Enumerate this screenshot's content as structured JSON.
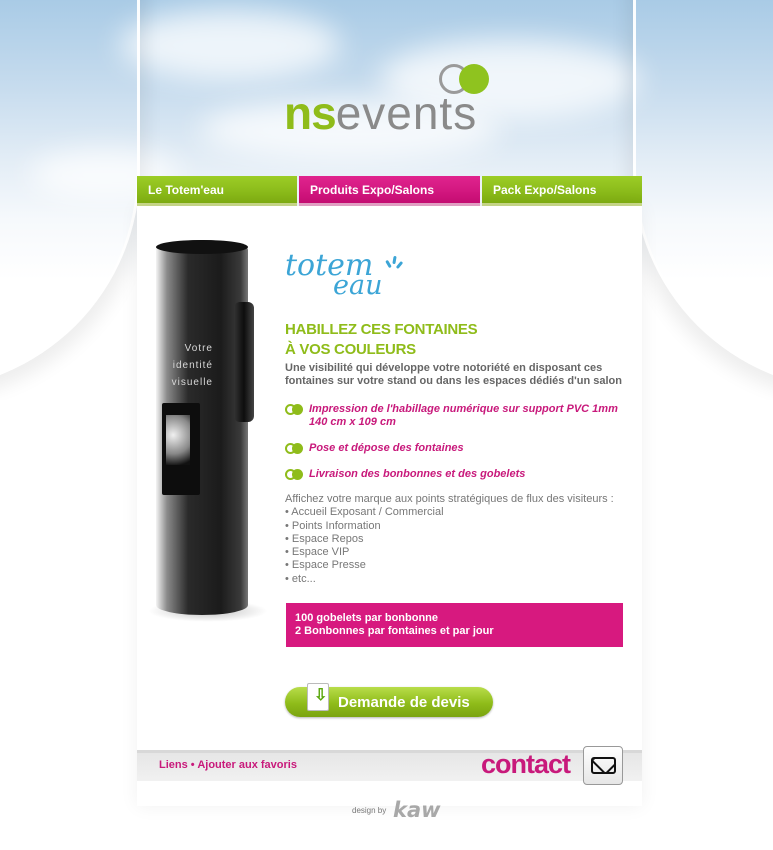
{
  "logo": {
    "part1": "ns",
    "part2": "events"
  },
  "nav": {
    "items": [
      {
        "label": "Le Totem'eau"
      },
      {
        "label": "Produits Expo/Salons"
      },
      {
        "label": "Pack Expo/Salons"
      }
    ]
  },
  "product": {
    "fountain_label": "Votre identité visuelle",
    "brand_line1": "totem",
    "brand_line2": "eau"
  },
  "content": {
    "headline_line1": "HABILLEZ CES FONTAINES",
    "headline_line2": "À VOS COULEURS",
    "intro": "Une visibilité qui développe votre notoriété en disposant ces fontaines sur votre stand ou dans les espaces dédiés d'un salon",
    "features": [
      "Impression de l'habillage numérique sur support PVC 1mm 140 cm x 109 cm",
      "Pose et dépose des fontaines",
      "Livraison des bonbonnes et des gobelets"
    ],
    "places_intro": "Affichez votre marque aux points stratégiques de flux des visiteurs :",
    "places": [
      "• Accueil Exposant / Commercial",
      "• Points Information",
      "• Espace Repos",
      "• Espace VIP",
      "• Espace Presse",
      "• etc..."
    ],
    "box_line1": "100 gobelets par bonbonne",
    "box_line2": "2 Bonbonnes par fontaines et par jour",
    "quote_button": "Demande de devis"
  },
  "footer": {
    "links": "Liens",
    "separator": "•",
    "favorites": "Ajouter aux favoris",
    "contact": "contact",
    "design_by": "design by",
    "designer": "kaw"
  },
  "colors": {
    "green": "#8fbc1a",
    "pink": "#c8197b",
    "sky": "#a9cbe6"
  }
}
